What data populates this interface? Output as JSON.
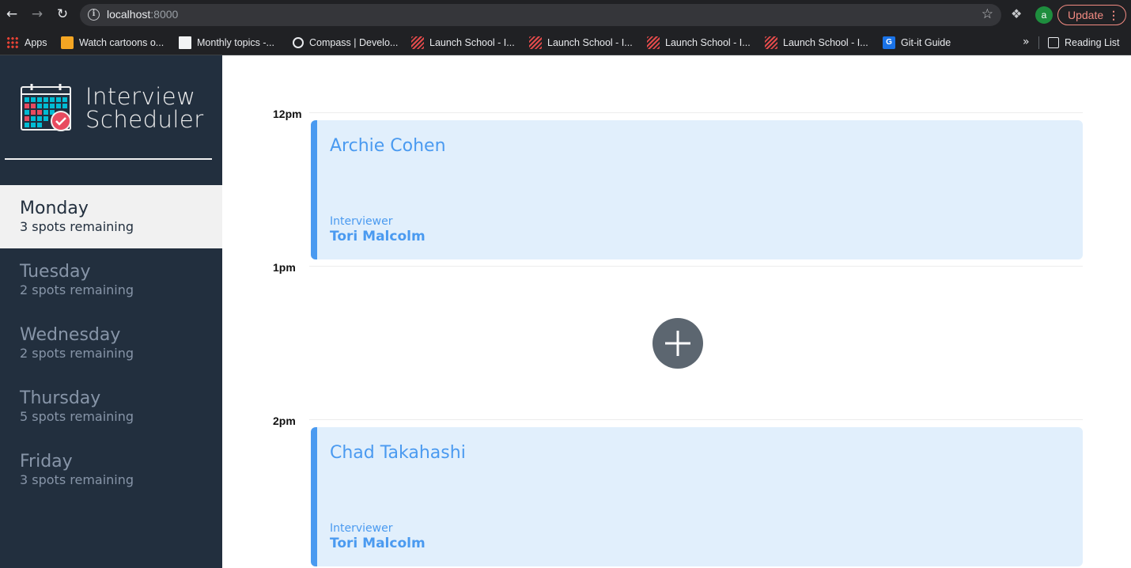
{
  "browser": {
    "url_host": "localhost",
    "url_port": ":8000",
    "avatar_letter": "a",
    "update_label": "Update",
    "update_menu": "⋮",
    "bookmarks": [
      {
        "label": "Apps",
        "icon": "apps-grid-icon"
      },
      {
        "label": "Watch cartoons o...",
        "icon": "cartoon-site-icon"
      },
      {
        "label": "Monthly topics -...",
        "icon": "document-icon"
      },
      {
        "label": "Compass | Develo...",
        "icon": "compass-icon"
      },
      {
        "label": "Launch School - I...",
        "icon": "launch-school-icon"
      },
      {
        "label": "Launch School - I...",
        "icon": "launch-school-icon"
      },
      {
        "label": "Launch School - I...",
        "icon": "launch-school-icon"
      },
      {
        "label": "Launch School - I...",
        "icon": "launch-school-icon"
      },
      {
        "label": "Git-it Guide",
        "icon": "git-it-icon"
      }
    ],
    "git_icon_letter": "G",
    "more_bookmarks": "»",
    "reading_list": "Reading List"
  },
  "app": {
    "brand_line1": "Interview",
    "brand_line2": "Scheduler",
    "days": [
      {
        "name": "Monday",
        "spots": "3 spots remaining",
        "selected": true
      },
      {
        "name": "Tuesday",
        "spots": "2 spots remaining",
        "selected": false
      },
      {
        "name": "Wednesday",
        "spots": "2 spots remaining",
        "selected": false
      },
      {
        "name": "Thursday",
        "spots": "5 spots remaining",
        "selected": false
      },
      {
        "name": "Friday",
        "spots": "3 spots remaining",
        "selected": false
      }
    ],
    "slots": [
      {
        "time": "12pm",
        "student": "Archie Cohen",
        "role_label": "Interviewer",
        "interviewer": "Tori Malcolm"
      },
      {
        "time": "1pm",
        "empty": true
      },
      {
        "time": "2pm",
        "student": "Chad Takahashi",
        "role_label": "Interviewer",
        "interviewer": "Tori Malcolm"
      }
    ]
  },
  "colors": {
    "sidebar": "#222f3e",
    "selected_day": "#f1f1f1",
    "appointment_bg": "#e1effc",
    "appointment_accent": "#4a9af0",
    "add_button": "#5c6670"
  }
}
